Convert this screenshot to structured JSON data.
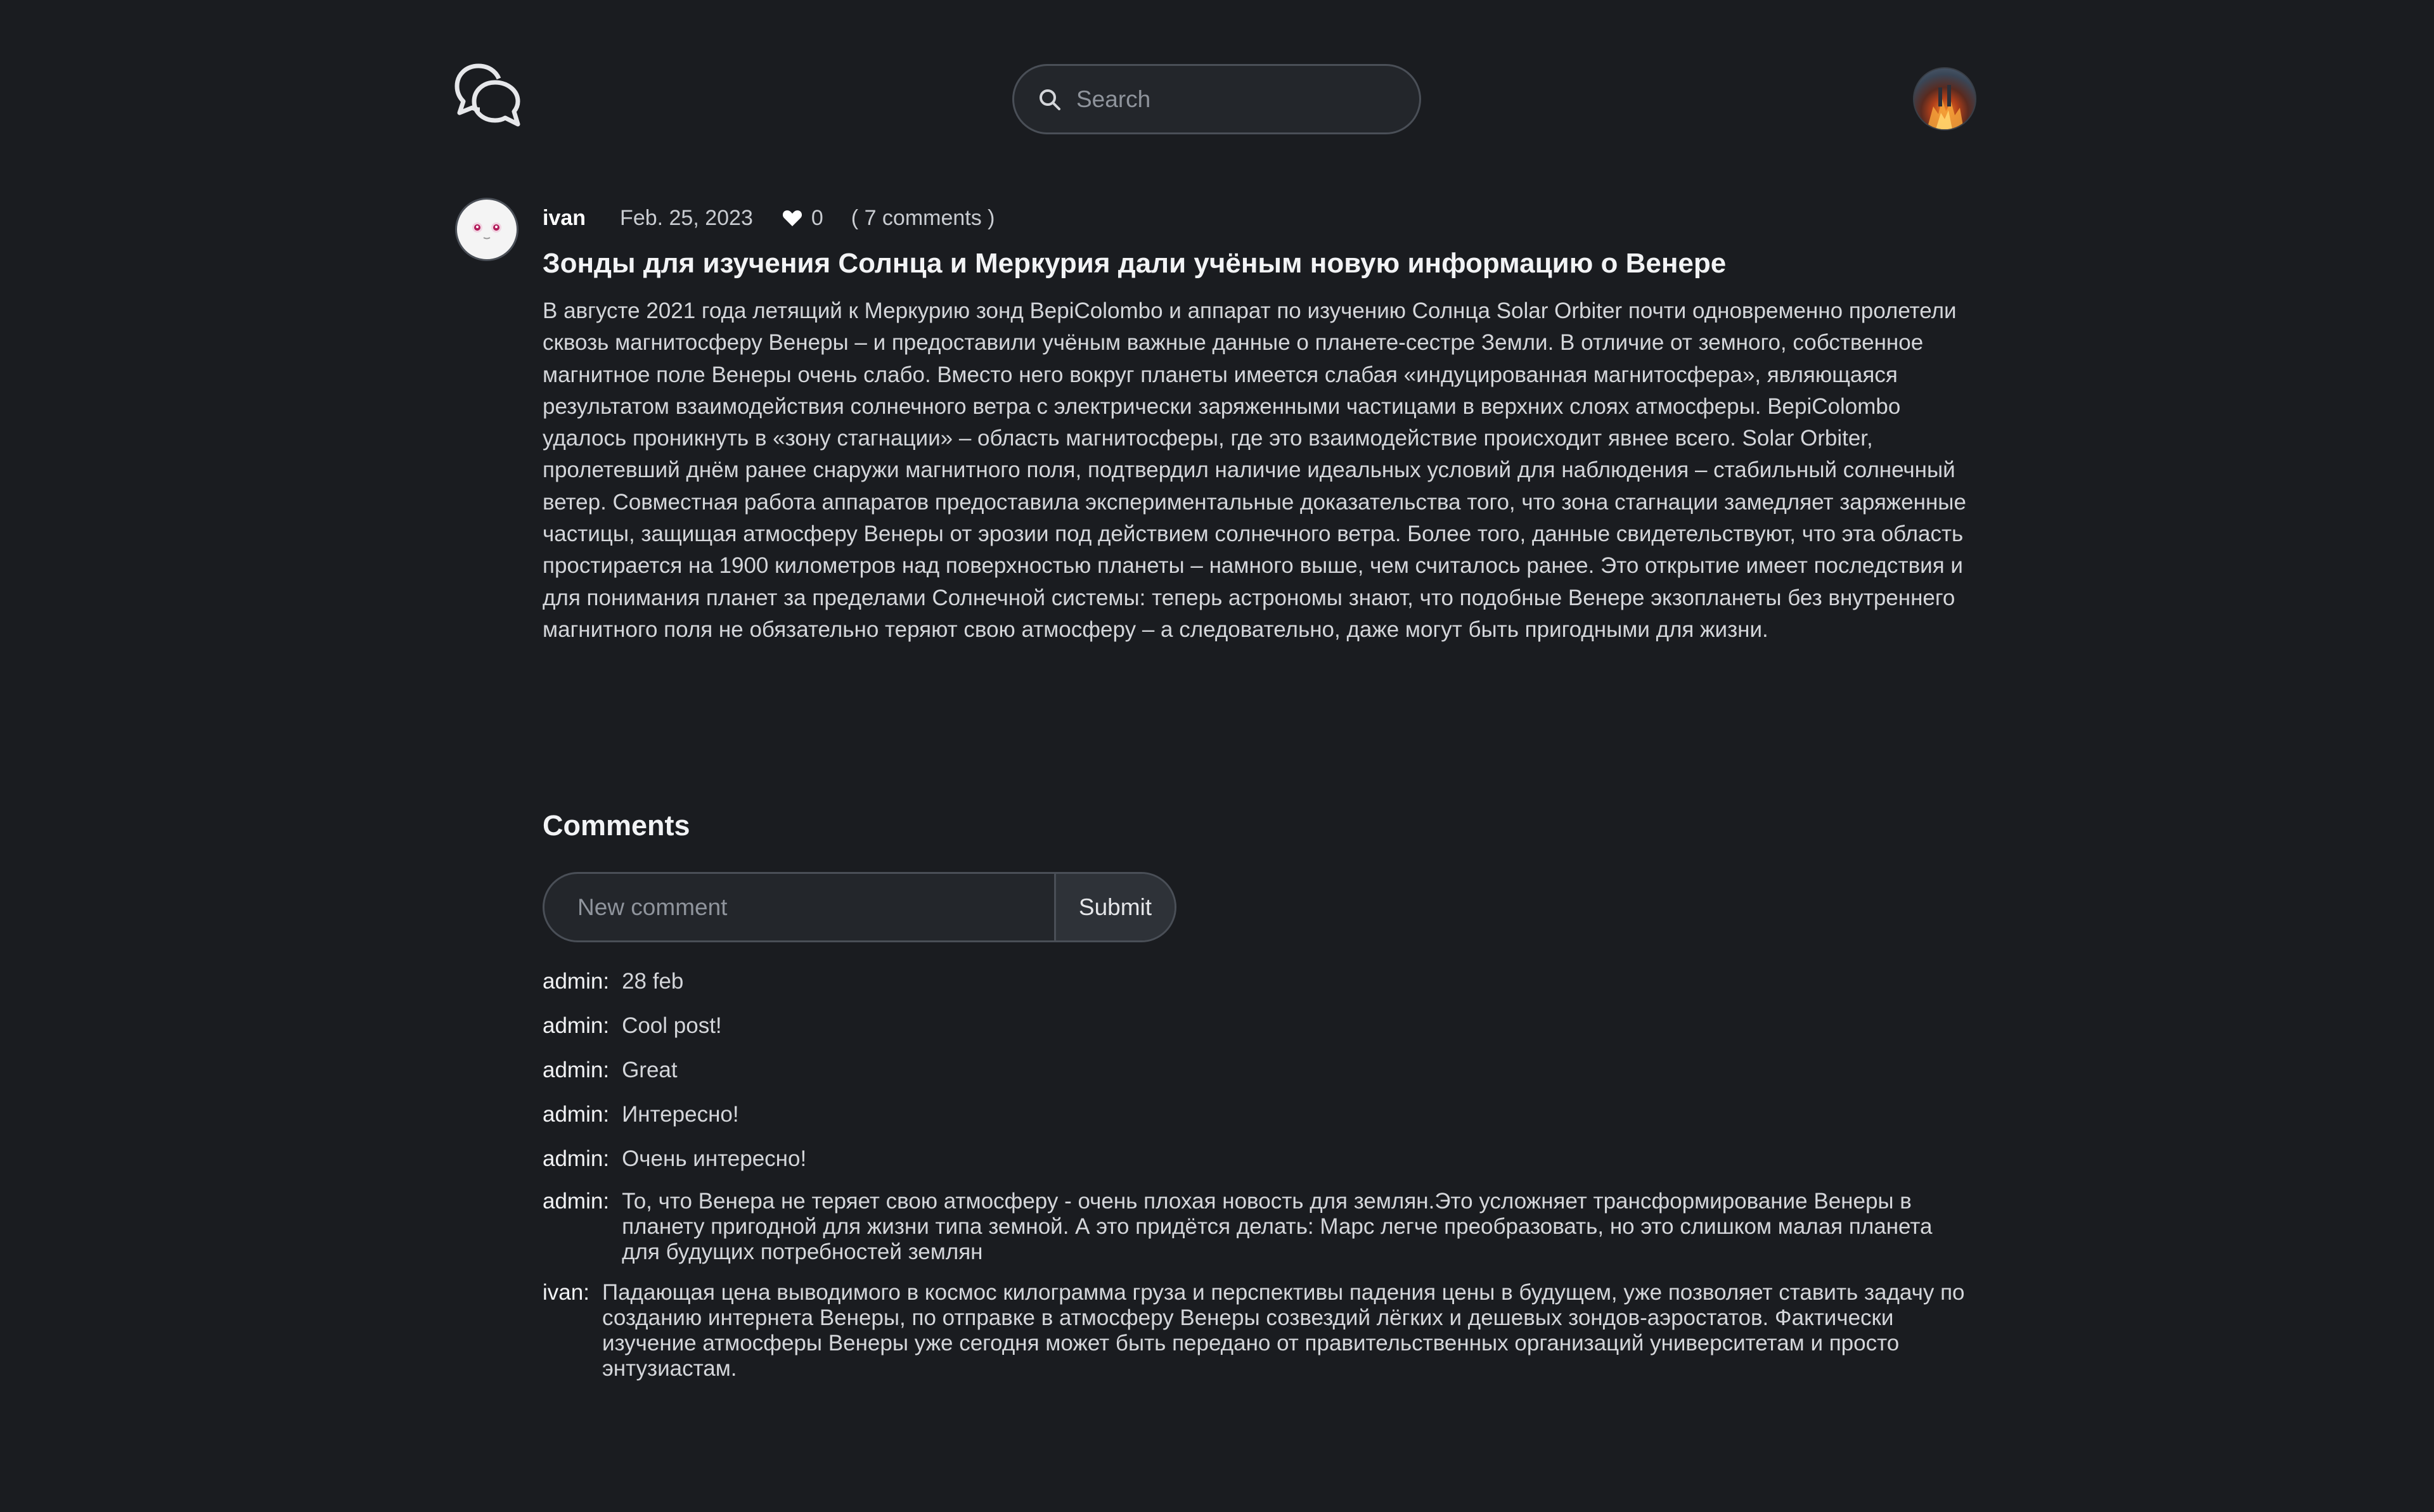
{
  "header": {
    "search_placeholder": "Search"
  },
  "post": {
    "author": "ivan",
    "date": "Feb. 25, 2023",
    "likes": "0",
    "comments_count": "( 7 comments )",
    "title": "Зонды для изучения Солнца и Меркурия дали учёным новую информацию о Венере",
    "body": "В августе 2021 года летящий к Меркурию зонд BepiColombo и аппарат по изучению Солнца Solar Orbiter почти одновременно пролетели сквозь магнитосферу Венеры – и предоставили учёным важные данные о планете-сестре Земли. В отличие от земного, собственное магнитное поле Венеры очень слабо. Вместо него вокруг планеты имеется слабая «индуцированная магнитосфера», являющаяся результатом взаимодействия солнечного ветра с электрически заряженными частицами в верхних слоях атмосферы. BepiColombo удалось проникнуть в «зону стагнации» – область магнитосферы, где это взаимодействие происходит явнее всего. Solar Orbiter, пролетевший днём ранее снаружи магнитного поля, подтвердил наличие идеальных условий для наблюдения – стабильный солнечный ветер. Совместная работа аппаратов предоставила экспериментальные доказательства того, что зона стагнации замедляет заряженные частицы, защищая атмосферу Венеры от эрозии под действием солнечного ветра. Более того, данные свидетельствуют, что эта область простирается на 1900 километров над поверхностью планеты – намного выше, чем считалось ранее. Это открытие имеет последствия и для понимания планет за пределами Солнечной системы: теперь астрономы знают, что подобные Венере экзопланеты без внутреннего магнитного поля не обязательно теряют свою атмосферу – а следовательно, даже могут быть пригодными для жизни."
  },
  "comments_section": {
    "heading": "Comments",
    "input_placeholder": "New comment",
    "submit_label": "Submit",
    "items": [
      {
        "author": "admin:",
        "text": "28 feb"
      },
      {
        "author": "admin:",
        "text": "Cool post!"
      },
      {
        "author": "admin:",
        "text": "Great"
      },
      {
        "author": "admin:",
        "text": "Интересно!"
      },
      {
        "author": "admin:",
        "text": "Очень интересно!"
      },
      {
        "author": "admin:",
        "text": "То, что Венера не теряет свою атмосферу - очень плохая новость для землян.Это усложняет трансформирование Венеры в планету пригодной для жизни типа земной. А это придётся делать: Марс легче преобразовать, но это слишком малая планета для будущих потребностей землян"
      },
      {
        "author": "ivan:",
        "text": "Падающая цена выводимого в космос килограмма груза и перспективы падения цены в будущем, уже позволяет ставить задачу по созданию интернета Венеры, по отправке в атмосферу Венеры созвездий лёгких и дешевых зондов-аэростатов. Фактически изучение атмосферы Венеры уже сегодня может быть передано от правительственных организаций университетам и просто энтузиастам."
      }
    ]
  },
  "icons": {
    "logo": "chat-bubbles-icon",
    "search": "search-icon",
    "like": "heart-icon"
  }
}
